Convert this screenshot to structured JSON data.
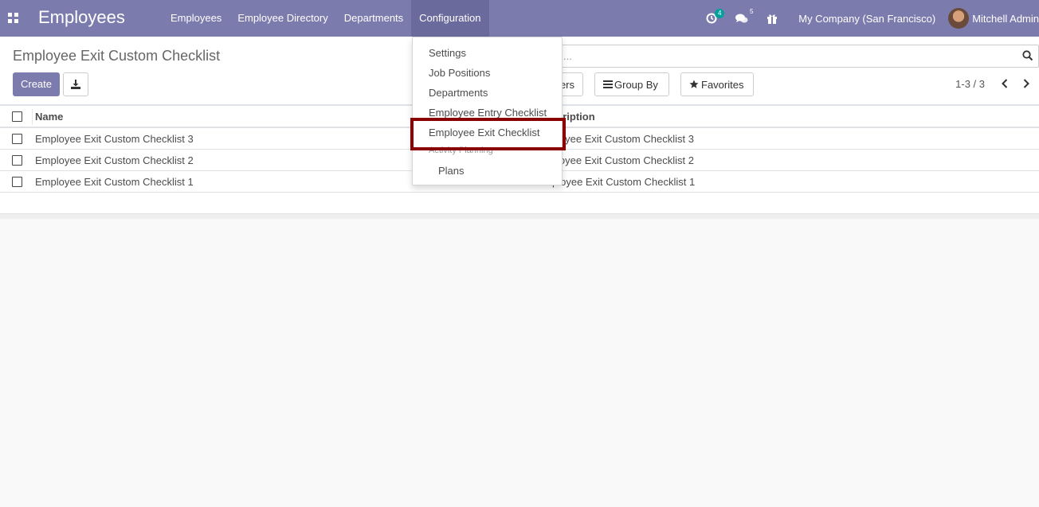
{
  "navbar": {
    "app_title": "Employees",
    "menu": [
      {
        "label": "Employees"
      },
      {
        "label": "Employee Directory"
      },
      {
        "label": "Departments"
      },
      {
        "label": "Configuration"
      }
    ],
    "activity_count": "4",
    "message_count": "5",
    "company": "My Company (San Francisco)",
    "user_name": "Mitchell Admin",
    "accent_color": "#7c7bad",
    "badge_color": "#00a09d"
  },
  "control_panel": {
    "breadcrumb": "Employee Exit Custom Checklist",
    "create_label": "Create",
    "search_placeholder": "...",
    "filters_label": "ers",
    "group_by_label": "Group By",
    "favorites_label": "Favorites",
    "pager": "1-3 / 3"
  },
  "table": {
    "columns": [
      "Name",
      "cription"
    ],
    "rows": [
      {
        "name": "Employee Exit Custom Checklist 3",
        "description": "loyee Exit Custom Checklist 3"
      },
      {
        "name": "Employee Exit Custom Checklist 2",
        "description": "loyee Exit Custom Checklist 2"
      },
      {
        "name": "Employee Exit Custom Checklist 1",
        "description": "ployee Exit Custom Checklist 1"
      }
    ]
  },
  "dropdown": {
    "items": [
      {
        "label": "Settings"
      },
      {
        "label": "Job Positions"
      },
      {
        "label": "Departments"
      },
      {
        "label": "Employee Entry Checklist"
      },
      {
        "label": "Employee Exit Checklist"
      }
    ],
    "section_header": "Activity Planning",
    "sub_items": [
      {
        "label": "Plans"
      }
    ],
    "highlight_color": "#8b0000"
  }
}
